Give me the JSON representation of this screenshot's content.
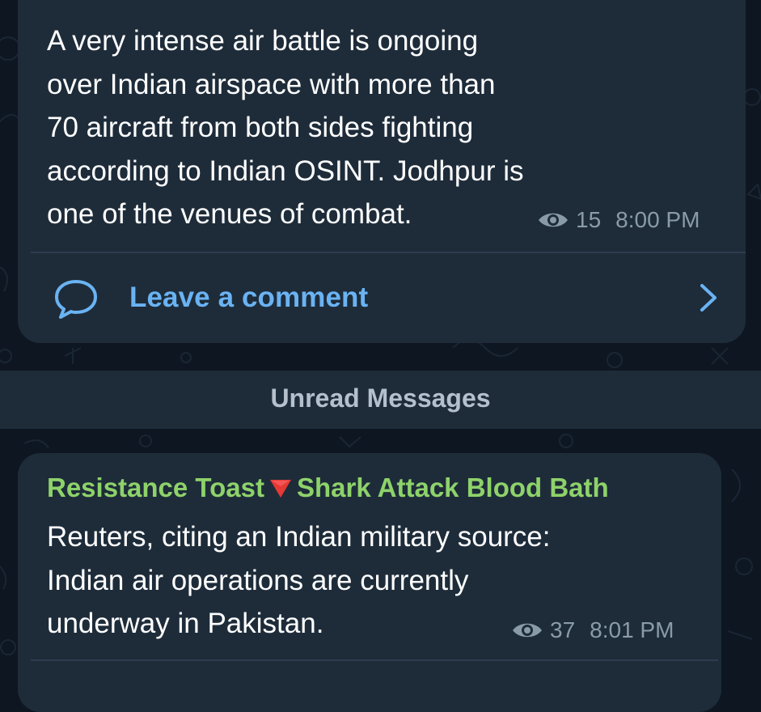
{
  "messages": [
    {
      "text": "A very intense air battle is ongoing\nover Indian airspace with more than\n70 aircraft from both sides fighting\naccording to Indian OSINT. Jodhpur is\none of the venues of combat.",
      "views": "15",
      "time": "8:00 PM",
      "comment_label": "Leave a comment"
    },
    {
      "sender_part1": "Resistance Toast",
      "sender_emoji": "red-triangle-down",
      "sender_part2": "Shark Attack Blood Bath",
      "text": "Reuters, citing an Indian military source:\nIndian air operations are currently\nunderway in Pakistan.",
      "views": "37",
      "time": "8:01 PM"
    }
  ],
  "divider": {
    "label": "Unread Messages"
  },
  "icons": {
    "views": "eye-icon",
    "comment": "speech-bubble-icon",
    "chevron": "chevron-right-icon",
    "emoji": "red-triangle-down-icon"
  },
  "colors": {
    "background": "#0e1621",
    "bubble": "#1e2c3a",
    "link": "#6ab3f3",
    "sender_name": "#8ed26a",
    "meta": "#8a9ba8",
    "emoji_red": "#e53935"
  }
}
